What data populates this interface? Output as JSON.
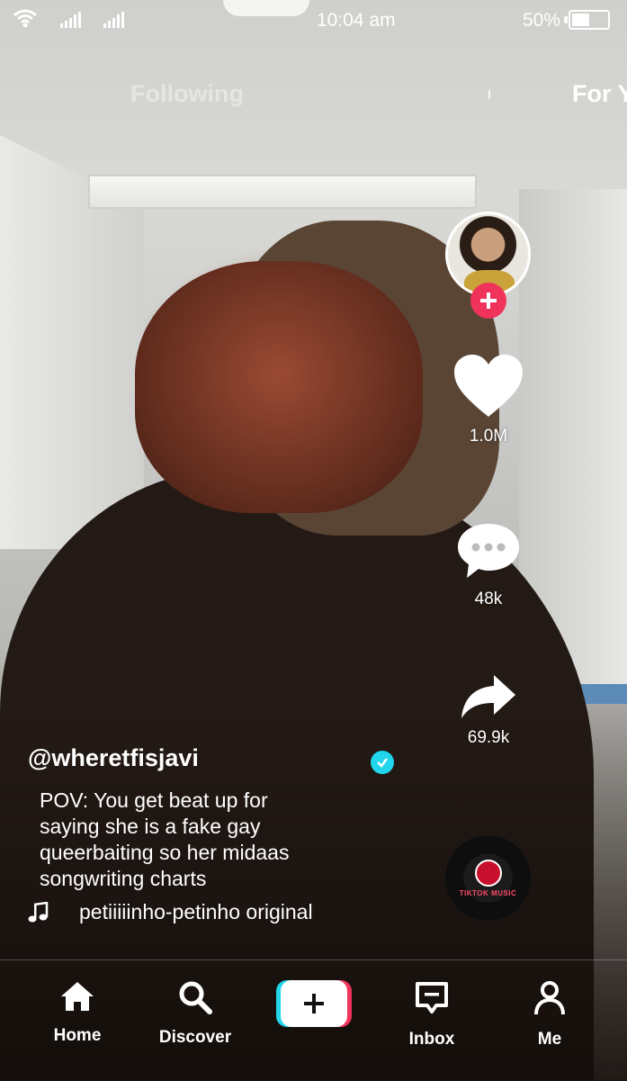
{
  "status_bar": {
    "time": "10:04 am",
    "battery_percent": "50%",
    "battery_level": 0.5
  },
  "feed_tabs": {
    "following": "Following",
    "for_you": "For Y"
  },
  "actions": {
    "likes": "1.0M",
    "comments": "48k",
    "shares": "69.9k"
  },
  "post": {
    "username": "@wheretfisjavi",
    "verified": true,
    "caption_lines": [
      "POV: You get beat up for",
      "saying she is a fake gay",
      "queerbaiting so her midaas",
      "songwriting charts"
    ],
    "sound": "petiiiiinho-petinho original"
  },
  "disc": {
    "brand": "TIKTOK MUSIC"
  },
  "nav": {
    "home": "Home",
    "discover": "Discover",
    "inbox": "Inbox",
    "me": "Me"
  },
  "colors": {
    "accent_red": "#f0335b",
    "accent_cyan": "#20d5ec"
  },
  "icons": [
    "wifi-icon",
    "signal-icon",
    "battery-icon",
    "plus-icon",
    "heart-icon",
    "comment-icon",
    "share-icon",
    "music-note-icon",
    "home-icon",
    "search-icon",
    "inbox-icon",
    "profile-icon",
    "verified-icon"
  ]
}
